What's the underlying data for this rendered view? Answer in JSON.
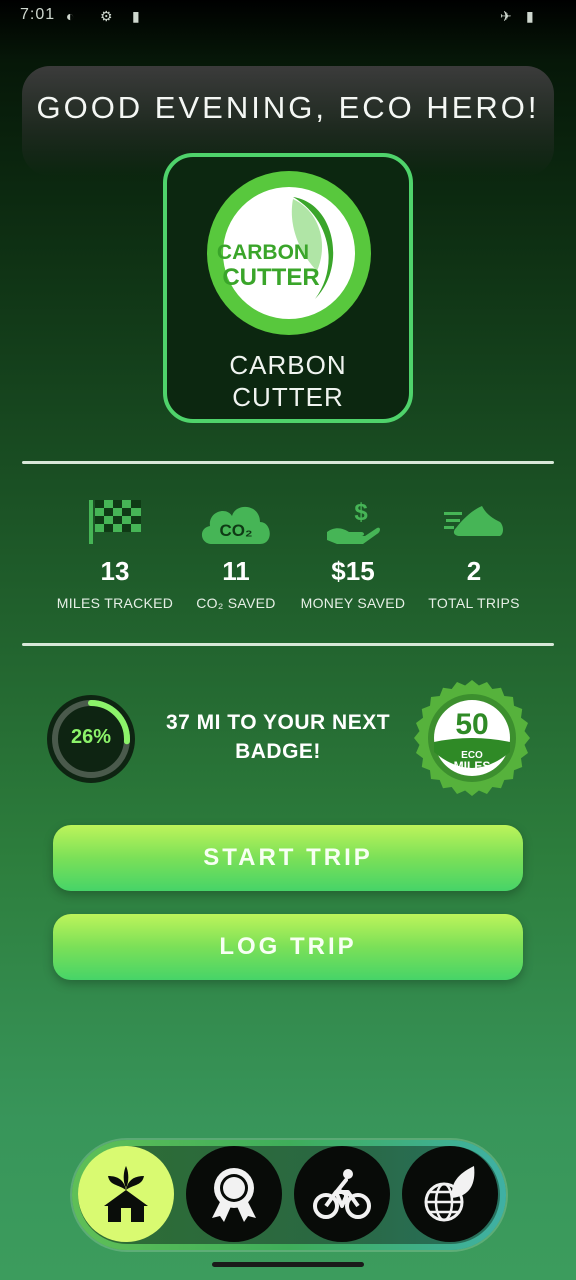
{
  "status_bar": {
    "time": "7:01"
  },
  "greeting": "GOOD EVENING, ECO HERO!",
  "featured_badge": {
    "emblem_line1": "CARBON",
    "emblem_line2": "CUTTER",
    "title_line1": "CARBON",
    "title_line2": "CUTTER"
  },
  "stats": [
    {
      "icon": "checkered-flag-icon",
      "value": "13",
      "label": "MILES TRACKED"
    },
    {
      "icon": "co2-cloud-icon",
      "value": "11",
      "label": "CO₂ SAVED",
      "icon_text": "CO₂"
    },
    {
      "icon": "money-hand-icon",
      "value": "$15",
      "label": "MONEY SAVED"
    },
    {
      "icon": "running-shoe-icon",
      "value": "2",
      "label": "TOTAL TRIPS"
    }
  ],
  "progress": {
    "percent": 26,
    "percent_label": "26%",
    "message": "37 MI TO YOUR NEXT BADGE!",
    "next_badge_number": "50",
    "next_badge_line1": "ECO",
    "next_badge_line2": "MILES"
  },
  "buttons": {
    "start_trip": "START TRIP",
    "log_trip": "LOG TRIP"
  },
  "nav": [
    {
      "icon": "eco-home-icon",
      "active": true
    },
    {
      "icon": "award-ribbon-icon",
      "active": false
    },
    {
      "icon": "bicycle-icon",
      "active": false
    },
    {
      "icon": "globe-leaf-icon",
      "active": false
    }
  ],
  "colors": {
    "accent": "#4fd36b",
    "progress": "#8cf36a",
    "nav_active": "#d9fa71"
  }
}
